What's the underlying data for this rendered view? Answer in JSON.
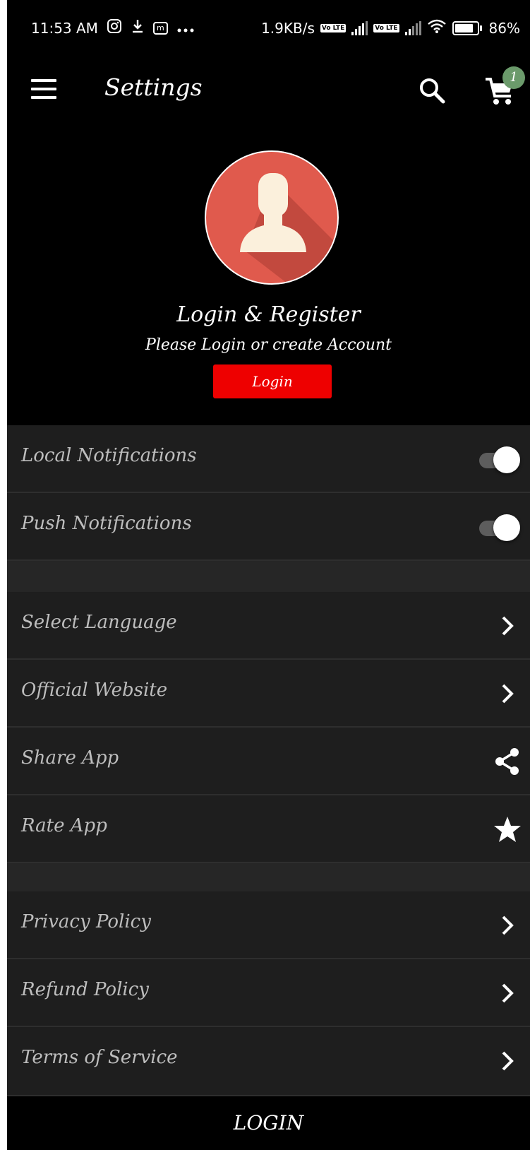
{
  "status_bar": {
    "time": "11:53 AM",
    "net_speed": "1.9KB/s",
    "volte": "Vo LTE",
    "battery": "86%"
  },
  "app_bar": {
    "title": "Settings",
    "cart_count": "1"
  },
  "profile": {
    "title": "Login & Register",
    "subtitle": "Please Login or create Account",
    "login_button": "Login"
  },
  "settings": {
    "local_notifications": {
      "label": "Local Notifications",
      "enabled": true
    },
    "push_notifications": {
      "label": "Push Notifications",
      "enabled": true
    },
    "select_language": "Select Language",
    "official_website": "Official Website",
    "share_app": "Share App",
    "rate_app": "Rate App",
    "privacy_policy": "Privacy Policy",
    "refund_policy": "Refund Policy",
    "terms_of_service": "Terms of Service"
  },
  "bottom_button": "LOGIN",
  "colors": {
    "accent_red": "#ee0000",
    "avatar_bg": "#e05a4d",
    "badge_green": "#6b9a6b",
    "row_bg": "#1e1e1e"
  }
}
